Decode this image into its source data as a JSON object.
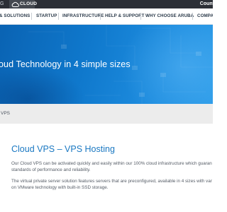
{
  "topbar": {
    "left_fragment": "G",
    "cloud_label": "CLOUD",
    "country_label": "Count"
  },
  "nav": {
    "items": [
      {
        "label": "& SOLUTIONS"
      },
      {
        "label": "STARTUP"
      },
      {
        "label": "INFRASTRUCTURE"
      },
      {
        "label": "HELP & SUPPORT"
      },
      {
        "label": "WHY CHOOSE ARUBA"
      },
      {
        "label": "COMPA"
      }
    ]
  },
  "hero": {
    "title": "oud Technology in 4 simple sizes"
  },
  "breadcrumb": {
    "current": "VPS"
  },
  "content": {
    "title": "Cloud VPS – VPS Hosting",
    "paragraph_1_line_1": "Our Cloud VPS can be activated quickly and easily within our 100% cloud infrastructure which guaran",
    "paragraph_1_line_2": "standards of performance and reliability.",
    "paragraph_2_line_1": "The virtual private server solution features servers that are preconfigured, available in 4 sizes with var",
    "paragraph_2_line_2": "on VMware technology with built-in SSD storage."
  },
  "colors": {
    "topbar_bg": "#2c2f36",
    "nav_text": "#2b3a4a",
    "hero_blue": "#0f78cc",
    "title_blue": "#1a78c2",
    "crumb_bg": "#ececec"
  }
}
